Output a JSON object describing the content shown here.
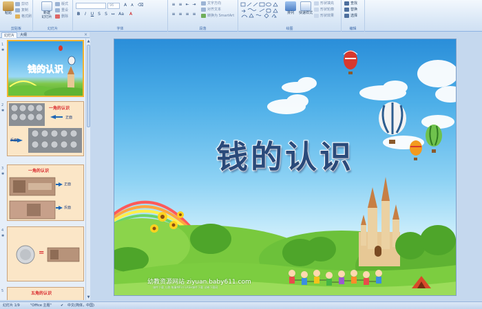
{
  "ribbon": {
    "clipboard": {
      "caption": "剪贴板",
      "paste": "粘贴",
      "cut": "剪切",
      "copy": "复制",
      "format_painter": "格式刷"
    },
    "slides": {
      "caption": "幻灯片",
      "new_slide": "新建\n幻灯片",
      "layout": "版式",
      "reset": "重设",
      "delete": "删除"
    },
    "font": {
      "caption": "字体",
      "font_name": "",
      "font_size": "96"
    },
    "paragraph": {
      "caption": "段落",
      "text_direction": "文字方向",
      "align_text": "对齐文本",
      "smartart": "转换为 SmartArt"
    },
    "drawing": {
      "caption": "绘图",
      "arrange": "排列",
      "quick_styles": "快速样式",
      "shape_fill": "形状填充",
      "shape_outline": "形状轮廓",
      "shape_effects": "形状效果"
    },
    "editing": {
      "caption": "编辑",
      "find": "查找",
      "replace": "替换",
      "select": "选择"
    }
  },
  "pane": {
    "tab_slides": "幻灯片",
    "tab_outline": "大纲",
    "close": "×",
    "thumbnails": [
      {
        "number": "1",
        "title": "钱的认识"
      },
      {
        "number": "2",
        "title": "一角的认识",
        "label_front": "正面",
        "label_back": "反面"
      },
      {
        "number": "3",
        "title": "一角的认识",
        "label_front": "正面",
        "label_back": "反面"
      },
      {
        "number": "4",
        "equals": "="
      },
      {
        "number": "5",
        "title": "五角的认识"
      }
    ]
  },
  "slide": {
    "title": "钱的认识",
    "watermark_site": "幼教资源网站  ziyuan.baby611.com",
    "watermark_sub": "课件下载   儿歌   故事MP3   FLASH课件下载   试卷下载网"
  },
  "status": {
    "slide_count": "幻灯片 1/9",
    "theme": "\"Office 主题\"",
    "language": "中文(简体，中国)"
  },
  "colors": {
    "ribbon_bg": "#dce9f7",
    "slide_sky": "#4dafe8",
    "grass": "#6cc13a",
    "thumb_selected_border": "#f3b331",
    "title_fill": "#2a4a7a"
  }
}
